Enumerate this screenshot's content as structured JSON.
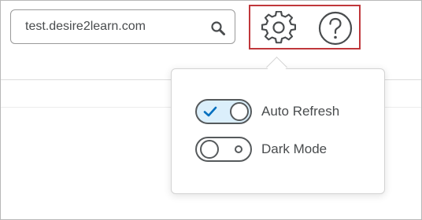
{
  "search": {
    "value": "test.desire2learn.com",
    "icon": "magnifier-icon"
  },
  "toolbar": {
    "settings_icon": "gear-icon",
    "help_icon": "question-circle-icon",
    "highlight_color": "#c0373b"
  },
  "settings_menu": {
    "toggles": [
      {
        "label": "Auto Refresh",
        "state": "on",
        "indicator": "checkmark"
      },
      {
        "label": "Dark Mode",
        "state": "off",
        "indicator": "ring"
      }
    ]
  },
  "colors": {
    "accent": "#006fbf",
    "toggle_on_fill": "#dbeffb",
    "text": "#494c4e"
  }
}
